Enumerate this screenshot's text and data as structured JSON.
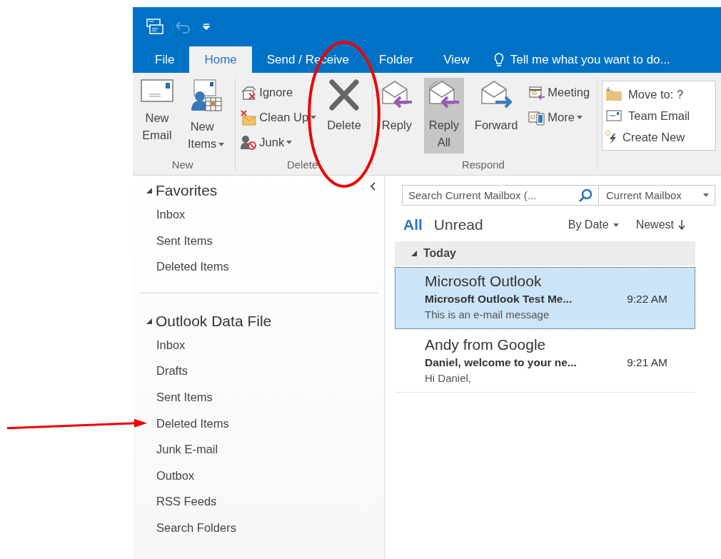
{
  "quick_access": [
    {
      "kind": "app"
    },
    {
      "kind": "undo",
      "disabled": true
    },
    {
      "kind": "customize"
    }
  ],
  "tabs": [
    {
      "label": "File",
      "selected": false
    },
    {
      "label": "Home",
      "selected": true
    },
    {
      "label": "Send / Receive",
      "selected": false
    },
    {
      "label": "Folder",
      "selected": false
    },
    {
      "label": "View",
      "selected": false
    }
  ],
  "tell_me": "Tell me what you want to do...",
  "ribbon_groups": [
    {
      "label": "New",
      "items": [
        {
          "kind": "large",
          "label": "New Email",
          "dropdown": false,
          "selected": false
        },
        {
          "kind": "large",
          "label": "New Items",
          "dropdown": true,
          "selected": false
        }
      ]
    },
    {
      "label": "Delete",
      "items": [
        {
          "kind": "stack",
          "items": [
            {
              "label": "Ignore",
              "dropdown": false
            },
            {
              "label": "Clean Up",
              "dropdown": true
            },
            {
              "label": "Junk",
              "dropdown": true
            }
          ]
        },
        {
          "kind": "large",
          "label": "Delete",
          "dropdown": false,
          "selected": false,
          "circled": true
        }
      ]
    },
    {
      "label": "Respond",
      "items": [
        {
          "kind": "large",
          "label": "Reply",
          "dropdown": false,
          "selected": false
        },
        {
          "kind": "large",
          "label": "Reply All",
          "dropdown": false,
          "selected": true
        },
        {
          "kind": "large",
          "label": "Forward",
          "dropdown": false,
          "selected": false
        },
        {
          "kind": "stack",
          "items": [
            {
              "label": "Meeting",
              "dropdown": false
            },
            {
              "label": "More",
              "dropdown": true
            }
          ]
        }
      ]
    },
    {
      "items": [
        {
          "kind": "gallery",
          "items": [
            {
              "label": "Move to: ?"
            },
            {
              "label": "Team Email"
            },
            {
              "label": "Create New"
            }
          ]
        }
      ]
    }
  ],
  "folder_pane": {
    "sections": [
      {
        "label": "Favorites",
        "expanded": true,
        "children": [
          {
            "label": "Inbox"
          },
          {
            "label": "Sent Items"
          },
          {
            "label": "Deleted Items"
          }
        ]
      },
      {
        "label": "Outlook Data File",
        "expanded": true,
        "children": [
          {
            "label": "Inbox"
          },
          {
            "label": "Drafts"
          },
          {
            "label": "Sent Items"
          },
          {
            "label": "Deleted Items",
            "arrow": true
          },
          {
            "label": "Junk E-mail"
          },
          {
            "label": "Outbox"
          },
          {
            "label": "RSS Feeds"
          },
          {
            "label": "Search Folders"
          }
        ]
      }
    ]
  },
  "message_list": {
    "search": {
      "placeholder": "Search Current Mailbox (..."
    },
    "scope": "Current Mailbox",
    "filters": [
      {
        "label": "All",
        "selected": true
      },
      {
        "label": "Unread",
        "selected": false
      }
    ],
    "sort": "By Date",
    "order": "Newest",
    "groups": [
      {
        "label": "Today",
        "expanded": true,
        "messages": [
          {
            "sender": "Microsoft Outlook",
            "subject": "Microsoft Outlook Test Me...",
            "time": "9:22 AM",
            "preview": "This is an e-mail message",
            "selected": true
          },
          {
            "sender": "Andy from Google",
            "subject": "Daniel, welcome to your ne...",
            "time": "9:21 AM",
            "preview": "Hi Daniel,",
            "selected": false
          }
        ]
      }
    ]
  }
}
